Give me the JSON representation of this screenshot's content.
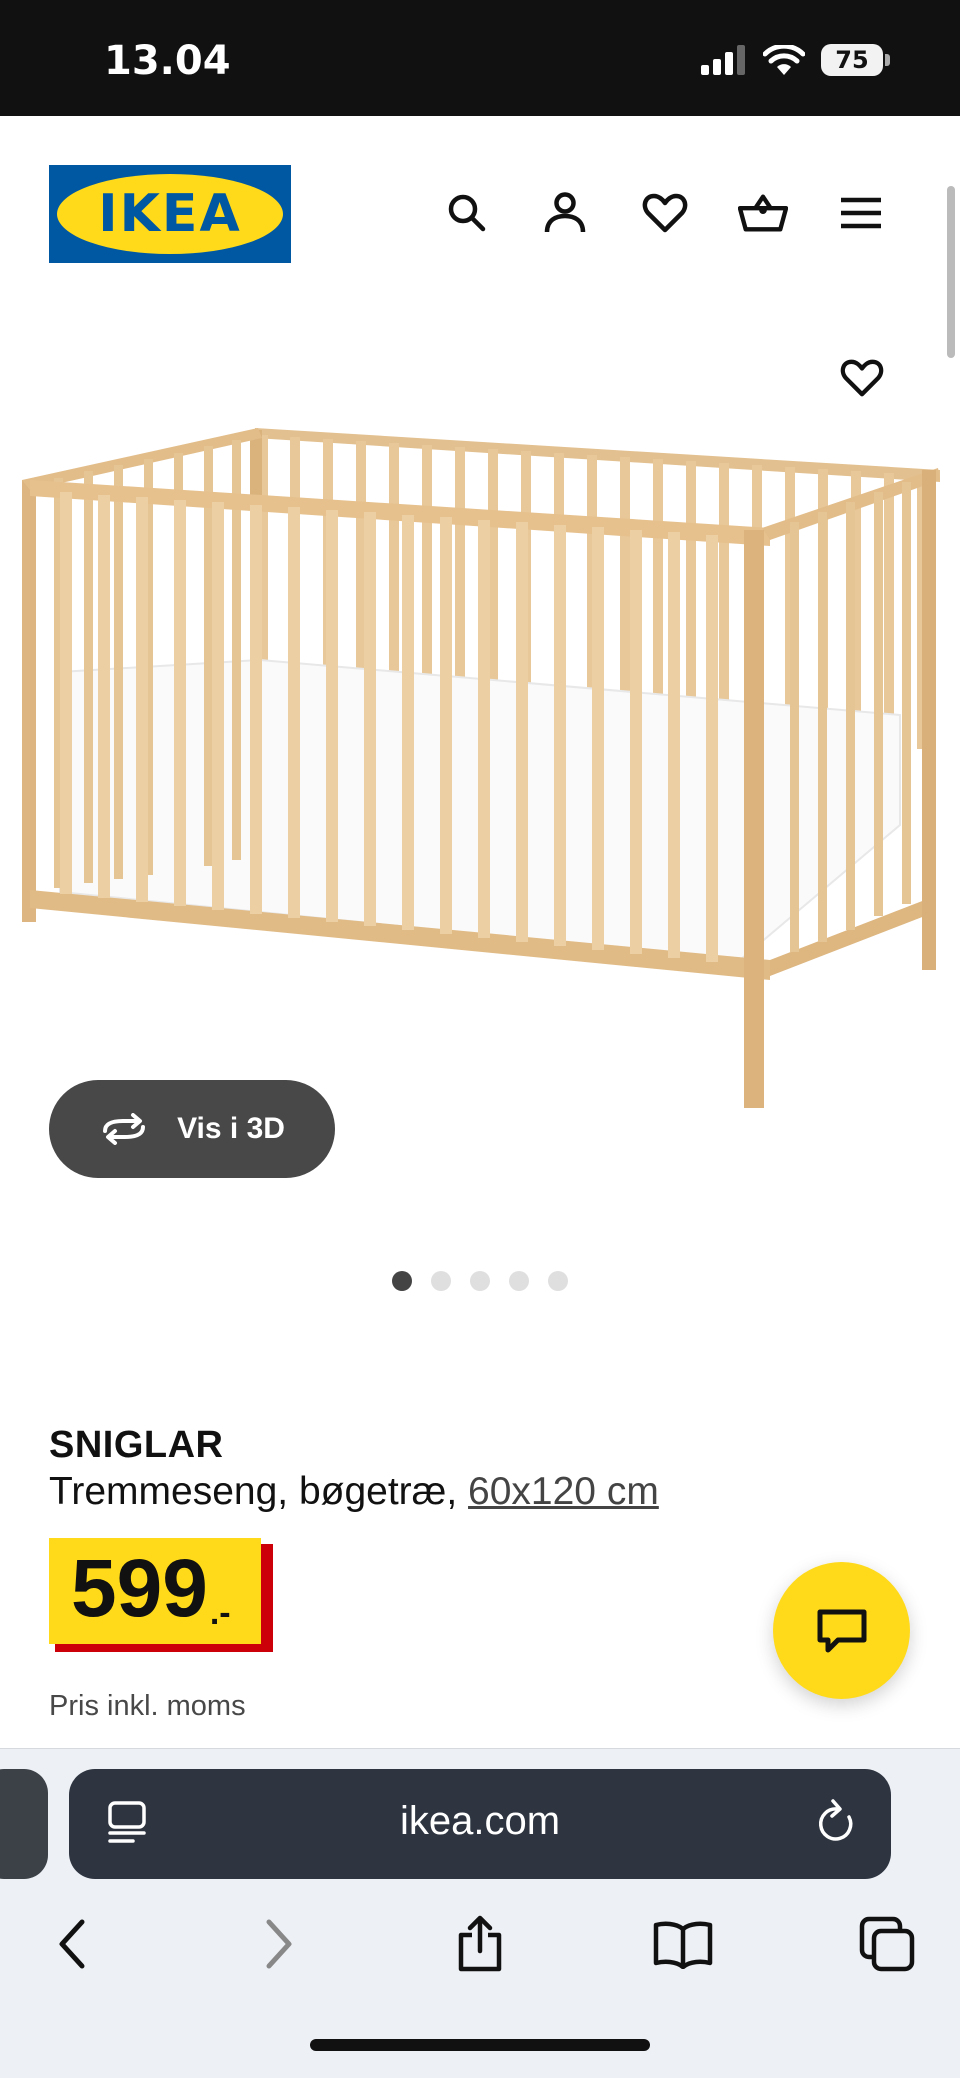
{
  "status_bar": {
    "time": "13.04",
    "battery": "75",
    "icons": [
      "signal-icon",
      "wifi-icon",
      "battery-icon"
    ]
  },
  "header": {
    "logo_text": "IKEA",
    "icons": [
      "search-icon",
      "account-icon",
      "heart-icon",
      "basket-icon",
      "menu-icon"
    ]
  },
  "gallery": {
    "view_3d_label": "Vis i 3D",
    "dot_count": 5,
    "active_dot": 1
  },
  "product": {
    "name": "SNIGLAR",
    "description": "Tremmeseng, bøgetræ, ",
    "size": "60x120 cm",
    "price_int": "599",
    "price_dec": ".-",
    "price_note": "Pris inkl. moms"
  },
  "browser": {
    "url": "ikea.com",
    "icons": [
      "reader-icon",
      "reload-icon",
      "back-icon",
      "forward-icon",
      "share-icon",
      "bookmarks-icon",
      "tabs-icon"
    ]
  },
  "colors": {
    "ikea_blue": "#0058a3",
    "ikea_yellow": "#ffda1a",
    "price_red": "#cc0008"
  }
}
